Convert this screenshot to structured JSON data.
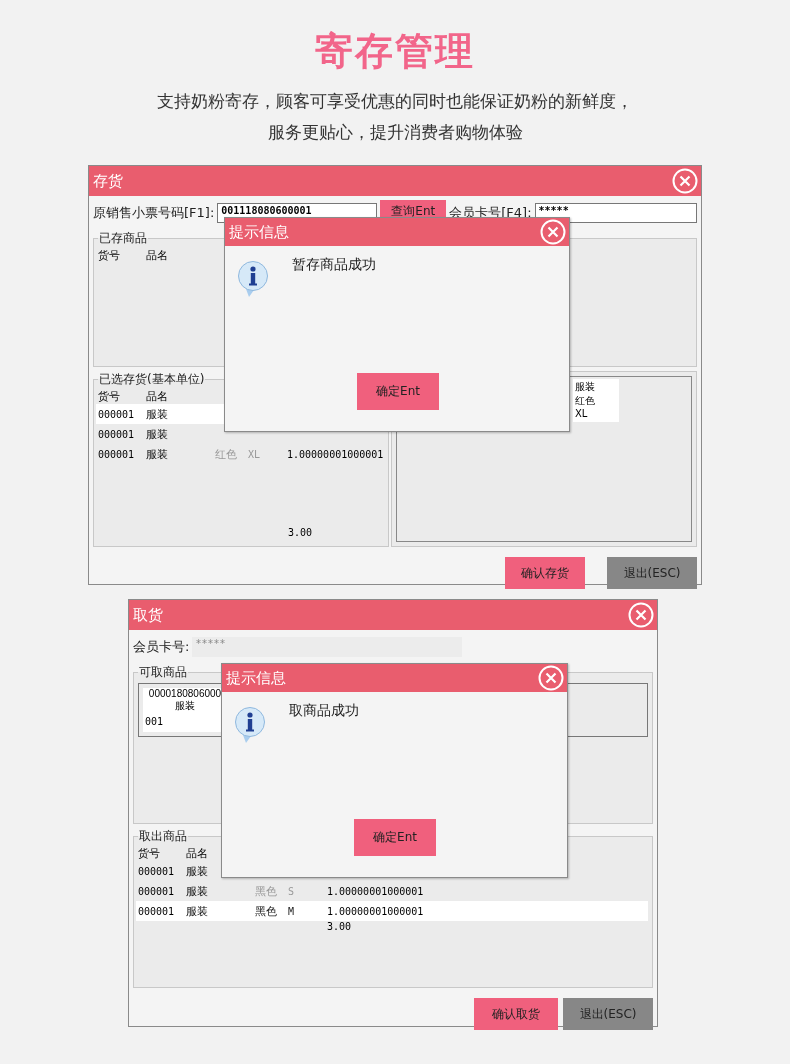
{
  "header": {
    "title": "寄存管理",
    "subtitle": [
      "支持奶粉寄存，顾客可享受优惠的同时也能保证奶粉的新鲜度，",
      "服务更贴心，提升消费者购物体验"
    ]
  },
  "deposit_window": {
    "title": "存货",
    "receipt_label": "原销售小票号码[F1]:",
    "receipt_value": "001118080600001",
    "query_button": "查询Ent",
    "member_label": "会员卡号[F4]:",
    "member_value": "*****",
    "stored_group": {
      "title": "已存商品",
      "columns": [
        "货号",
        "品名"
      ]
    },
    "selected_group": {
      "title": "已选存货(基本单位)",
      "columns": [
        "货号",
        "品名"
      ],
      "rows": [
        {
          "code": "000001",
          "name": "服装",
          "selected": true
        },
        {
          "code": "000001",
          "name": "服装",
          "selected": false
        },
        {
          "code": "000001",
          "name": "服装",
          "shade": "红色",
          "size": "XL",
          "qty": "1.00000001000001",
          "selected": false
        }
      ],
      "total": "3.00"
    },
    "preview_card": [
      "服装",
      "红色",
      "XL"
    ],
    "buttons": [
      {
        "label": "确认存货",
        "kind": "primary"
      },
      {
        "label": "退出(ESC)",
        "kind": "secondary"
      }
    ],
    "dialog": {
      "title": "提示信息",
      "message": "暂存商品成功",
      "button": "确定Ent"
    }
  },
  "pickup_window": {
    "title": "取货",
    "member_label": "会员卡号:",
    "member_value": "*****",
    "available_group": {
      "title": "可取商品",
      "card": [
        "0000180806000",
        "服装"
      ],
      "card_code": "001"
    },
    "taken_group": {
      "title": "取出商品",
      "columns": [
        "货号",
        "品名"
      ],
      "rows": [
        {
          "code": "000001",
          "name": "服装",
          "selected": false
        },
        {
          "code": "000001",
          "name": "服装",
          "shade": "黑色",
          "size": "S",
          "qty": "1.00000001000001",
          "selected": false
        },
        {
          "code": "000001",
          "name": "服装",
          "shade": "黑色",
          "size": "M",
          "qty": "1.00000001000001",
          "selected": true
        }
      ],
      "total": "3.00"
    },
    "buttons": [
      {
        "label": "确认取货",
        "kind": "primary"
      },
      {
        "label": "退出(ESC)",
        "kind": "secondary"
      }
    ],
    "dialog": {
      "title": "提示信息",
      "message": "取商品成功",
      "button": "确定Ent"
    }
  }
}
